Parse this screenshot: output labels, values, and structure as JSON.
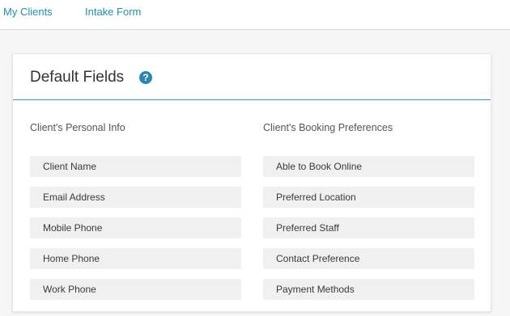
{
  "nav": {
    "tabs": [
      {
        "label": "My Clients"
      },
      {
        "label": "Intake Form"
      }
    ]
  },
  "section": {
    "title": "Default Fields",
    "help_icon": "question-circle-icon",
    "help_glyph": "?"
  },
  "columns": [
    {
      "title": "Client's Personal Info",
      "fields": [
        "Client Name",
        "Email Address",
        "Mobile Phone",
        "Home Phone",
        "Work Phone"
      ]
    },
    {
      "title": "Client's Booking Preferences",
      "fields": [
        "Able to Book Online",
        "Preferred Location",
        "Preferred Staff",
        "Contact Preference",
        "Payment Methods"
      ]
    }
  ],
  "colors": {
    "link": "#1d8fb0",
    "accent": "#2f9bbd",
    "help_icon_bg": "#2a86b5",
    "field_bg": "#f0f0f0"
  }
}
